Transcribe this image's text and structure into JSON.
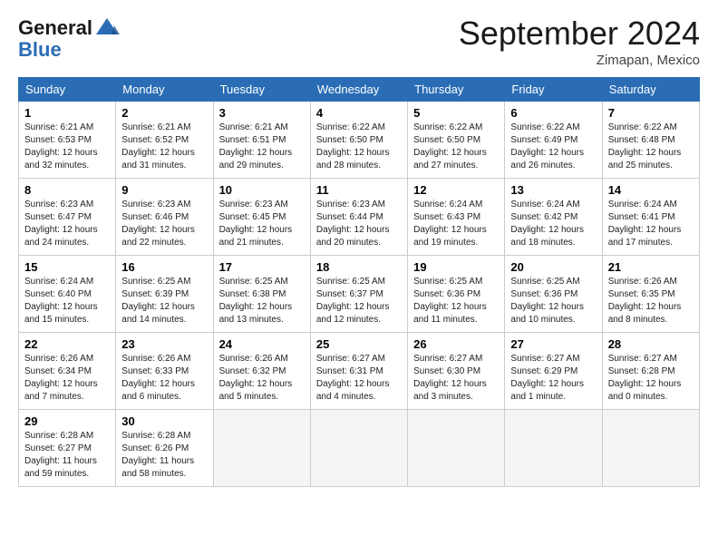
{
  "header": {
    "logo_line1": "General",
    "logo_line2": "Blue",
    "month_title": "September 2024",
    "location": "Zimapan, Mexico"
  },
  "weekdays": [
    "Sunday",
    "Monday",
    "Tuesday",
    "Wednesday",
    "Thursday",
    "Friday",
    "Saturday"
  ],
  "weeks": [
    [
      {
        "day": "1",
        "info": "Sunrise: 6:21 AM\nSunset: 6:53 PM\nDaylight: 12 hours\nand 32 minutes."
      },
      {
        "day": "2",
        "info": "Sunrise: 6:21 AM\nSunset: 6:52 PM\nDaylight: 12 hours\nand 31 minutes."
      },
      {
        "day": "3",
        "info": "Sunrise: 6:21 AM\nSunset: 6:51 PM\nDaylight: 12 hours\nand 29 minutes."
      },
      {
        "day": "4",
        "info": "Sunrise: 6:22 AM\nSunset: 6:50 PM\nDaylight: 12 hours\nand 28 minutes."
      },
      {
        "day": "5",
        "info": "Sunrise: 6:22 AM\nSunset: 6:50 PM\nDaylight: 12 hours\nand 27 minutes."
      },
      {
        "day": "6",
        "info": "Sunrise: 6:22 AM\nSunset: 6:49 PM\nDaylight: 12 hours\nand 26 minutes."
      },
      {
        "day": "7",
        "info": "Sunrise: 6:22 AM\nSunset: 6:48 PM\nDaylight: 12 hours\nand 25 minutes."
      }
    ],
    [
      {
        "day": "8",
        "info": "Sunrise: 6:23 AM\nSunset: 6:47 PM\nDaylight: 12 hours\nand 24 minutes."
      },
      {
        "day": "9",
        "info": "Sunrise: 6:23 AM\nSunset: 6:46 PM\nDaylight: 12 hours\nand 22 minutes."
      },
      {
        "day": "10",
        "info": "Sunrise: 6:23 AM\nSunset: 6:45 PM\nDaylight: 12 hours\nand 21 minutes."
      },
      {
        "day": "11",
        "info": "Sunrise: 6:23 AM\nSunset: 6:44 PM\nDaylight: 12 hours\nand 20 minutes."
      },
      {
        "day": "12",
        "info": "Sunrise: 6:24 AM\nSunset: 6:43 PM\nDaylight: 12 hours\nand 19 minutes."
      },
      {
        "day": "13",
        "info": "Sunrise: 6:24 AM\nSunset: 6:42 PM\nDaylight: 12 hours\nand 18 minutes."
      },
      {
        "day": "14",
        "info": "Sunrise: 6:24 AM\nSunset: 6:41 PM\nDaylight: 12 hours\nand 17 minutes."
      }
    ],
    [
      {
        "day": "15",
        "info": "Sunrise: 6:24 AM\nSunset: 6:40 PM\nDaylight: 12 hours\nand 15 minutes."
      },
      {
        "day": "16",
        "info": "Sunrise: 6:25 AM\nSunset: 6:39 PM\nDaylight: 12 hours\nand 14 minutes."
      },
      {
        "day": "17",
        "info": "Sunrise: 6:25 AM\nSunset: 6:38 PM\nDaylight: 12 hours\nand 13 minutes."
      },
      {
        "day": "18",
        "info": "Sunrise: 6:25 AM\nSunset: 6:37 PM\nDaylight: 12 hours\nand 12 minutes."
      },
      {
        "day": "19",
        "info": "Sunrise: 6:25 AM\nSunset: 6:36 PM\nDaylight: 12 hours\nand 11 minutes."
      },
      {
        "day": "20",
        "info": "Sunrise: 6:25 AM\nSunset: 6:36 PM\nDaylight: 12 hours\nand 10 minutes."
      },
      {
        "day": "21",
        "info": "Sunrise: 6:26 AM\nSunset: 6:35 PM\nDaylight: 12 hours\nand 8 minutes."
      }
    ],
    [
      {
        "day": "22",
        "info": "Sunrise: 6:26 AM\nSunset: 6:34 PM\nDaylight: 12 hours\nand 7 minutes."
      },
      {
        "day": "23",
        "info": "Sunrise: 6:26 AM\nSunset: 6:33 PM\nDaylight: 12 hours\nand 6 minutes."
      },
      {
        "day": "24",
        "info": "Sunrise: 6:26 AM\nSunset: 6:32 PM\nDaylight: 12 hours\nand 5 minutes."
      },
      {
        "day": "25",
        "info": "Sunrise: 6:27 AM\nSunset: 6:31 PM\nDaylight: 12 hours\nand 4 minutes."
      },
      {
        "day": "26",
        "info": "Sunrise: 6:27 AM\nSunset: 6:30 PM\nDaylight: 12 hours\nand 3 minutes."
      },
      {
        "day": "27",
        "info": "Sunrise: 6:27 AM\nSunset: 6:29 PM\nDaylight: 12 hours\nand 1 minute."
      },
      {
        "day": "28",
        "info": "Sunrise: 6:27 AM\nSunset: 6:28 PM\nDaylight: 12 hours\nand 0 minutes."
      }
    ],
    [
      {
        "day": "29",
        "info": "Sunrise: 6:28 AM\nSunset: 6:27 PM\nDaylight: 11 hours\nand 59 minutes."
      },
      {
        "day": "30",
        "info": "Sunrise: 6:28 AM\nSunset: 6:26 PM\nDaylight: 11 hours\nand 58 minutes."
      },
      {
        "day": "",
        "info": ""
      },
      {
        "day": "",
        "info": ""
      },
      {
        "day": "",
        "info": ""
      },
      {
        "day": "",
        "info": ""
      },
      {
        "day": "",
        "info": ""
      }
    ]
  ]
}
